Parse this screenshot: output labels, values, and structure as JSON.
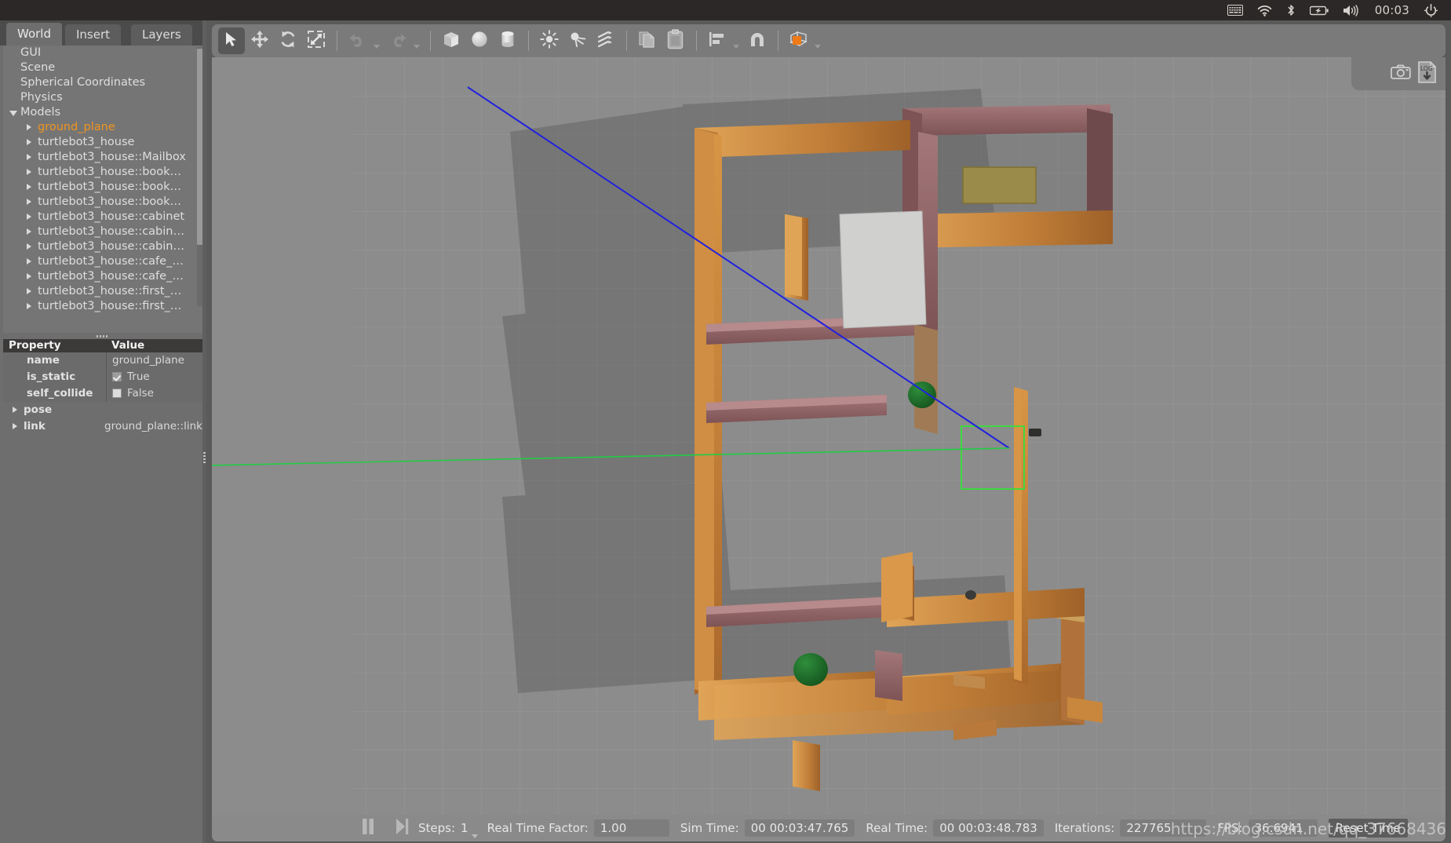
{
  "system_bar": {
    "clock": "00:03",
    "icons": [
      "keyboard-icon",
      "wifi-icon",
      "bluetooth-icon",
      "battery-icon",
      "volume-icon",
      "power-icon"
    ]
  },
  "left_panel": {
    "tabs": [
      {
        "label": "World",
        "active": true
      },
      {
        "label": "Insert",
        "active": false
      },
      {
        "label": "Layers",
        "active": false
      }
    ],
    "tree": [
      {
        "label": "GUI",
        "level": 1,
        "arrow": "none",
        "selected": false
      },
      {
        "label": "Scene",
        "level": 1,
        "arrow": "none",
        "selected": false
      },
      {
        "label": "Spherical Coordinates",
        "level": 1,
        "arrow": "none",
        "selected": false
      },
      {
        "label": "Physics",
        "level": 1,
        "arrow": "none",
        "selected": false
      },
      {
        "label": "Models",
        "level": 1,
        "arrow": "down",
        "selected": false
      },
      {
        "label": "ground_plane",
        "level": 2,
        "arrow": "right",
        "selected": true
      },
      {
        "label": "turtlebot3_house",
        "level": 2,
        "arrow": "right",
        "selected": false
      },
      {
        "label": "turtlebot3_house::Mailbox",
        "level": 2,
        "arrow": "right",
        "selected": false
      },
      {
        "label": "turtlebot3_house::book…",
        "level": 2,
        "arrow": "right",
        "selected": false
      },
      {
        "label": "turtlebot3_house::book…",
        "level": 2,
        "arrow": "right",
        "selected": false
      },
      {
        "label": "turtlebot3_house::book…",
        "level": 2,
        "arrow": "right",
        "selected": false
      },
      {
        "label": "turtlebot3_house::cabinet",
        "level": 2,
        "arrow": "right",
        "selected": false
      },
      {
        "label": "turtlebot3_house::cabin…",
        "level": 2,
        "arrow": "right",
        "selected": false
      },
      {
        "label": "turtlebot3_house::cabin…",
        "level": 2,
        "arrow": "right",
        "selected": false
      },
      {
        "label": "turtlebot3_house::cafe_…",
        "level": 2,
        "arrow": "right",
        "selected": false
      },
      {
        "label": "turtlebot3_house::cafe_…",
        "level": 2,
        "arrow": "right",
        "selected": false
      },
      {
        "label": "turtlebot3_house::first_…",
        "level": 2,
        "arrow": "right",
        "selected": false
      },
      {
        "label": "turtlebot3_house::first_…",
        "level": 2,
        "arrow": "right",
        "selected": false
      }
    ],
    "property_table": {
      "headers": [
        "Property",
        "Value"
      ],
      "rows": [
        {
          "key": "name",
          "value": "ground_plane",
          "kind": "text"
        },
        {
          "key": "is_static",
          "value": "True",
          "kind": "checkbox",
          "checked": true
        },
        {
          "key": "self_collide",
          "value": "False",
          "kind": "checkbox",
          "checked": false
        },
        {
          "key": "pose",
          "value": "",
          "kind": "group"
        },
        {
          "key": "link",
          "value": "ground_plane::link",
          "kind": "group"
        }
      ]
    }
  },
  "toolbar": {
    "items": [
      {
        "name": "select-mode-button",
        "icon": "cursor-arrow-icon",
        "active": true
      },
      {
        "name": "translate-mode-button",
        "icon": "move-arrows-icon",
        "active": false
      },
      {
        "name": "rotate-mode-button",
        "icon": "rotate-arrows-icon",
        "active": false
      },
      {
        "name": "scale-mode-button",
        "icon": "scale-diagonal-icon",
        "active": false
      },
      {
        "name": "separator-1",
        "icon": "separator",
        "active": false
      },
      {
        "name": "undo-button",
        "icon": "undo-arrow-icon",
        "active": false
      },
      {
        "name": "undo-history-dropdown",
        "icon": "chevron-down-icon",
        "active": false
      },
      {
        "name": "redo-button",
        "icon": "redo-arrow-icon",
        "active": false
      },
      {
        "name": "redo-history-dropdown",
        "icon": "chevron-down-icon",
        "active": false
      },
      {
        "name": "separator-2",
        "icon": "separator",
        "active": false
      },
      {
        "name": "insert-box-button",
        "icon": "box-icon",
        "active": false
      },
      {
        "name": "insert-sphere-button",
        "icon": "sphere-icon",
        "active": false
      },
      {
        "name": "insert-cylinder-button",
        "icon": "cylinder-icon",
        "active": false
      },
      {
        "name": "separator-3",
        "icon": "separator",
        "active": false
      },
      {
        "name": "insert-point-light-button",
        "icon": "point-light-icon",
        "active": false
      },
      {
        "name": "insert-spot-light-button",
        "icon": "spot-light-icon",
        "active": false
      },
      {
        "name": "insert-directional-light-button",
        "icon": "directional-light-icon",
        "active": false
      },
      {
        "name": "separator-4",
        "icon": "separator",
        "active": false
      },
      {
        "name": "copy-button",
        "icon": "copy-icon",
        "active": false
      },
      {
        "name": "paste-button",
        "icon": "paste-icon",
        "active": false
      },
      {
        "name": "separator-5",
        "icon": "separator",
        "active": false
      },
      {
        "name": "align-button",
        "icon": "align-icon",
        "active": false
      },
      {
        "name": "align-dropdown",
        "icon": "chevron-down-icon",
        "active": false
      },
      {
        "name": "snap-button",
        "icon": "magnet-icon",
        "active": false
      },
      {
        "name": "separator-6",
        "icon": "separator",
        "active": false
      },
      {
        "name": "view-angle-button",
        "icon": "orange-cube-icon",
        "active": false
      },
      {
        "name": "view-angle-dropdown",
        "icon": "chevron-down-icon",
        "active": false
      }
    ]
  },
  "viewport": {
    "corner_buttons": [
      {
        "name": "screenshot-button",
        "icon": "camera-icon",
        "label": ""
      },
      {
        "name": "log-button",
        "icon": "log-download-icon",
        "label": "LOG"
      }
    ]
  },
  "status_bar": {
    "pause_button": "pause-icon",
    "step_button": "step-forward-icon",
    "steps_label": "Steps:",
    "steps_value": "1",
    "real_time_factor_label": "Real Time Factor:",
    "real_time_factor_value": "1.00",
    "sim_time_label": "Sim Time:",
    "sim_time_value": "00 00:03:47.765",
    "real_time_label": "Real Time:",
    "real_time_value": "00 00:03:48.783",
    "iterations_label": "Iterations:",
    "iterations_value": "227765",
    "fps_label": "FPS:",
    "fps_value": "36.6941",
    "reset_time_label": "Reset Time"
  },
  "watermark": "https://blog.csdn.net/qq_37668436",
  "colors": {
    "accent_orange": "#f0941f",
    "panel_gray": "#6e6e6e",
    "toolbar_gray": "#7a7a7a",
    "viewport_gray": "#8c8c8c",
    "sysbar_dark": "#2b2827"
  }
}
